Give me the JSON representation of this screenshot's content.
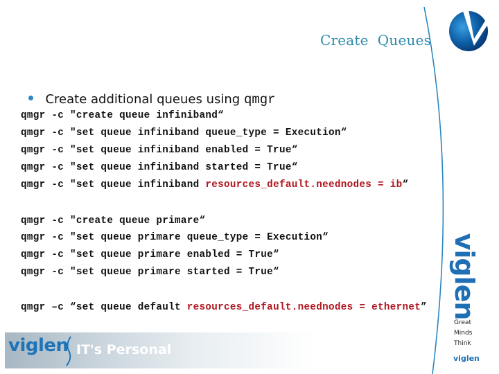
{
  "header": {
    "title": "Create  Queues"
  },
  "bullet": {
    "text": "Create additional queues using ",
    "command": "qmgr"
  },
  "code": {
    "block1": [
      {
        "plain": "qmgr -c \"create queue infiniband“",
        "highlight": ""
      },
      {
        "plain": "qmgr -c \"set queue infiniband queue_type = Execution“",
        "highlight": ""
      },
      {
        "plain": "qmgr -c \"set queue infiniband enabled = True“",
        "highlight": ""
      },
      {
        "plain": "qmgr -c \"set queue infiniband started = True“",
        "highlight": ""
      },
      {
        "plain": "qmgr -c \"set queue infiniband ",
        "highlight": "resources_default.neednodes = ib",
        "tail": "“"
      }
    ],
    "block2": [
      {
        "plain": "qmgr -c \"create queue primare“",
        "highlight": ""
      },
      {
        "plain": "qmgr -c \"set queue primare queue_type = Execution“",
        "highlight": ""
      },
      {
        "plain": "qmgr -c \"set queue primare enabled = True“",
        "highlight": ""
      },
      {
        "plain": "qmgr -c \"set queue primare started = True“",
        "highlight": ""
      }
    ],
    "block3": [
      {
        "plain": "qmgr –c “set queue default ",
        "highlight": "resources_default.neednodes = ethernet",
        "tail": "”"
      }
    ]
  },
  "branding": {
    "footer_brand": "viglen",
    "footer_tagline": "IT's Personal",
    "side_brand": "viglen",
    "slogan": [
      "Great",
      "Minds",
      "Think"
    ],
    "small_brand": "viglen",
    "colors": {
      "brand_blue": "#1f6fb5",
      "title_teal": "#2f8cab",
      "highlight_red": "#b0151f"
    }
  }
}
